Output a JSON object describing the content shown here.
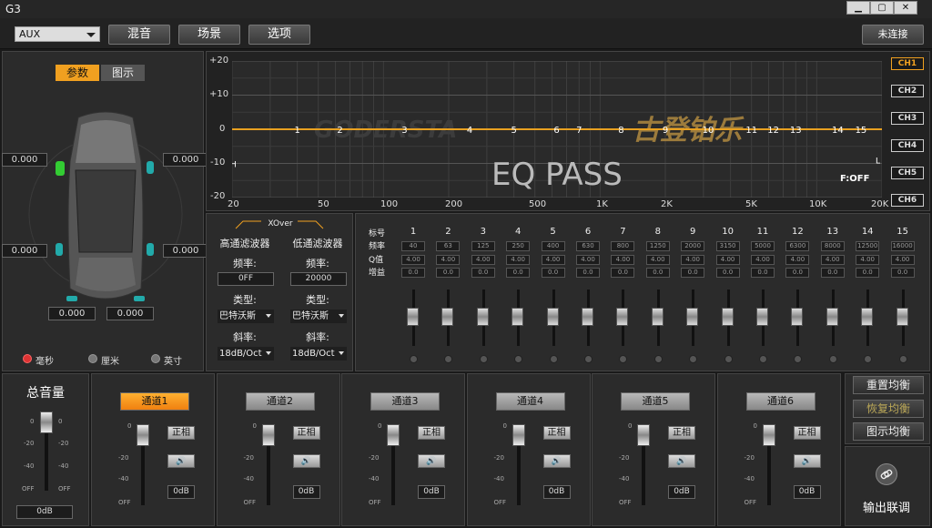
{
  "window": {
    "title": "G3",
    "minimize": "▁",
    "restore": "▢",
    "close": "✕"
  },
  "toolbar": {
    "source": "AUX",
    "buttons": [
      "混音",
      "场景",
      "选项"
    ],
    "connect": "未连接"
  },
  "left": {
    "tabs": [
      "参数",
      "图示"
    ],
    "measurements": [
      "0.000",
      "0.000",
      "0.000",
      "0.000",
      "0.000",
      "0.000"
    ],
    "units": [
      {
        "label": "毫秒",
        "selected": true
      },
      {
        "label": "厘米",
        "selected": false
      },
      {
        "label": "英寸",
        "selected": false
      }
    ]
  },
  "graph": {
    "y_ticks": [
      "+20",
      "+10",
      "0",
      "-10",
      "-20"
    ],
    "x_ticks": [
      "20",
      "50",
      "100",
      "200",
      "500",
      "1K",
      "2K",
      "5K",
      "10K",
      "20K"
    ],
    "band_markers": [
      "1",
      "2",
      "3",
      "4",
      "5",
      "6",
      "7",
      "8",
      "9",
      "10",
      "11",
      "12",
      "13",
      "14",
      "15"
    ],
    "h_marker": "H",
    "l_marker": "L",
    "watermark_en": "GODERSTA",
    "watermark_cn": "古登铂乐",
    "status": "EQ PASS",
    "filter_status": "F:OFF",
    "line_color": "#e8a020",
    "channels": [
      "CH1",
      "CH2",
      "CH3",
      "CH4",
      "CH5",
      "CH6"
    ],
    "active_channel": "CH1"
  },
  "xover": {
    "title": "XOver",
    "hp": {
      "title": "高通滤波器",
      "freq_label": "频率:",
      "freq": "0FF",
      "type_label": "类型:",
      "type": "巴特沃斯",
      "slope_label": "斜率:",
      "slope": "18dB/Oct"
    },
    "lp": {
      "title": "低通滤波器",
      "freq_label": "频率:",
      "freq": "20000",
      "type_label": "类型:",
      "type": "巴特沃斯",
      "slope_label": "斜率:",
      "slope": "18dB/Oct"
    }
  },
  "eq": {
    "row_labels": [
      "标号",
      "频率",
      "Q值",
      "增益"
    ],
    "bands": [
      {
        "n": "1",
        "f": "40",
        "q": "4.00",
        "g": "0.0"
      },
      {
        "n": "2",
        "f": "63",
        "q": "4.00",
        "g": "0.0"
      },
      {
        "n": "3",
        "f": "125",
        "q": "4.00",
        "g": "0.0"
      },
      {
        "n": "4",
        "f": "250",
        "q": "4.00",
        "g": "0.0"
      },
      {
        "n": "5",
        "f": "400",
        "q": "4.00",
        "g": "0.0"
      },
      {
        "n": "6",
        "f": "630",
        "q": "4.00",
        "g": "0.0"
      },
      {
        "n": "7",
        "f": "800",
        "q": "4.00",
        "g": "0.0"
      },
      {
        "n": "8",
        "f": "1250",
        "q": "4.00",
        "g": "0.0"
      },
      {
        "n": "9",
        "f": "2000",
        "q": "4.00",
        "g": "0.0"
      },
      {
        "n": "10",
        "f": "3150",
        "q": "4.00",
        "g": "0.0"
      },
      {
        "n": "11",
        "f": "5000",
        "q": "4.00",
        "g": "0.0"
      },
      {
        "n": "12",
        "f": "6300",
        "q": "4.00",
        "g": "0.0"
      },
      {
        "n": "13",
        "f": "8000",
        "q": "4.00",
        "g": "0.0"
      },
      {
        "n": "14",
        "f": "12500",
        "q": "4.00",
        "g": "0.0"
      },
      {
        "n": "15",
        "f": "16000",
        "q": "4.00",
        "g": "0.0"
      }
    ]
  },
  "master": {
    "title": "总音量",
    "ticks": [
      "0",
      "-20",
      "-40",
      "OFF"
    ],
    "value": "0dB",
    "level_db": 0
  },
  "channels": {
    "ticks": [
      "0",
      "-20",
      "-40",
      "OFF"
    ],
    "phase_label": "正相",
    "mute_icon": "🔊",
    "items": [
      {
        "name": "通道1",
        "db": "0dB",
        "active": true
      },
      {
        "name": "通道2",
        "db": "0dB",
        "active": false
      },
      {
        "name": "通道3",
        "db": "0dB",
        "active": false
      },
      {
        "name": "通道4",
        "db": "0dB",
        "active": false
      },
      {
        "name": "通道5",
        "db": "0dB",
        "active": false
      },
      {
        "name": "通道6",
        "db": "0dB",
        "active": false
      }
    ]
  },
  "side": {
    "reset": "重置均衡",
    "restore": "恢复均衡",
    "graphic": "图示均衡",
    "link_label": "输出联调"
  }
}
